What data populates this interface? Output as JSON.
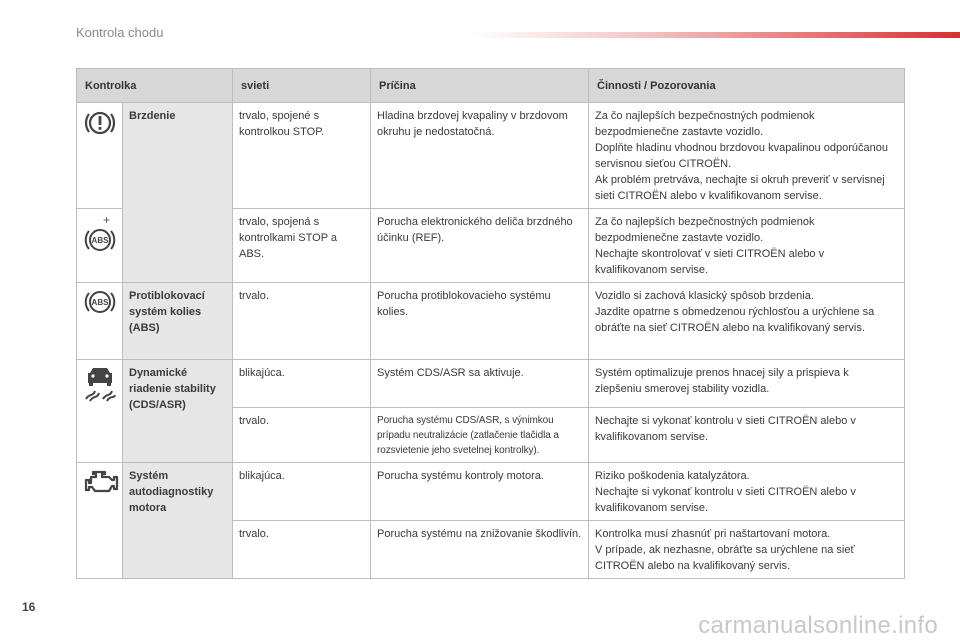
{
  "header": {
    "title": "Kontrola chodu"
  },
  "table": {
    "columns": [
      "Kontrolka",
      "svieti",
      "Príčina",
      "Činnosti / Pozorovania"
    ],
    "rows": [
      {
        "name": "Brzdenie",
        "state": "trvalo, spojené s kontrolkou STOP.",
        "cause": "Hladina brzdovej kvapaliny v brzdovom okruhu je nedostatočná.",
        "action_lines": [
          "Za čo najlepších bezpečnostných podmienok bezpodmienečne zastavte vozidlo.",
          "Doplňte hladinu vhodnou brzdovou kvapalinou odporúčanou servisnou sieťou CITROËN.",
          "Ak problém pretrváva, nechajte si okruh preveriť v servisnej sieti CITROËN alebo v kvalifikovanom servise."
        ]
      },
      {
        "plus": "+",
        "state": "trvalo, spojená s kontrolkami STOP a ABS.",
        "cause": "Porucha elektronického deliča brzdného účinku (REF).",
        "action_lines": [
          "Za čo najlepších bezpečnostných podmienok bezpodmienečne zastavte vozidlo.",
          "Nechajte skontrolovať v sieti CITROËN alebo v kvalifikovanom servise."
        ]
      },
      {
        "name": "Protiblokovací systém kolies (ABS)",
        "state": "trvalo.",
        "cause": "Porucha protiblokovacieho systému kolies.",
        "action_lines": [
          "Vozidlo si zachová klasický spôsob brzdenia.",
          "Jazdite opatrne s obmedzenou rýchlosťou a urýchlene sa obráťte na sieť CITROËN alebo na kvalifikovaný servis."
        ]
      },
      {
        "name": "Dynamické riadenie stability (CDS/ASR)",
        "state": "blikajúca.",
        "cause": "Systém CDS/ASR sa aktivuje.",
        "action_lines": [
          "Systém optimalizuje prenos hnacej sily a prispieva k zlepšeniu smerovej stability vozidla."
        ]
      },
      {
        "state": "trvalo.",
        "cause": "Porucha systému CDS/ASR, s výnimkou prípadu neutralizácie (zatlačenie tlačidla a rozsvietenie jeho svetelnej kontrolky).",
        "action_lines": [
          "Nechajte si vykonať kontrolu v sieti CITROËN alebo v kvalifikovanom servise."
        ]
      },
      {
        "name": "Systém autodiagnostiky motora",
        "state": "blikajúca.",
        "cause": "Porucha systému kontroly motora.",
        "action_lines": [
          "Riziko poškodenia katalyzátora.",
          "Nechajte si vykonať kontrolu v sieti CITROËN alebo v kvalifikovanom servise."
        ]
      },
      {
        "state": "trvalo.",
        "cause": "Porucha systému na znižovanie škodlivín.",
        "action_lines": [
          "Kontrolka musí zhasnúť pri naštartovaní motora.",
          "V prípade, ak nezhasne, obráťte sa urýchlene na sieť CITROËN alebo na kvalifikovaný servis."
        ]
      }
    ]
  },
  "icons": {
    "brake": "brake-warning-icon",
    "abs": "abs-icon",
    "stability": "skid-car-icon",
    "engine": "engine-check-icon"
  },
  "colors": {
    "icon_stroke": "#444444",
    "name_bg": "#e6e6e6",
    "header_bg": "#d7d7d7",
    "accent": "#d62f2f"
  },
  "footer": {
    "page_number": "16",
    "watermark": "carmanualsonline.info"
  }
}
